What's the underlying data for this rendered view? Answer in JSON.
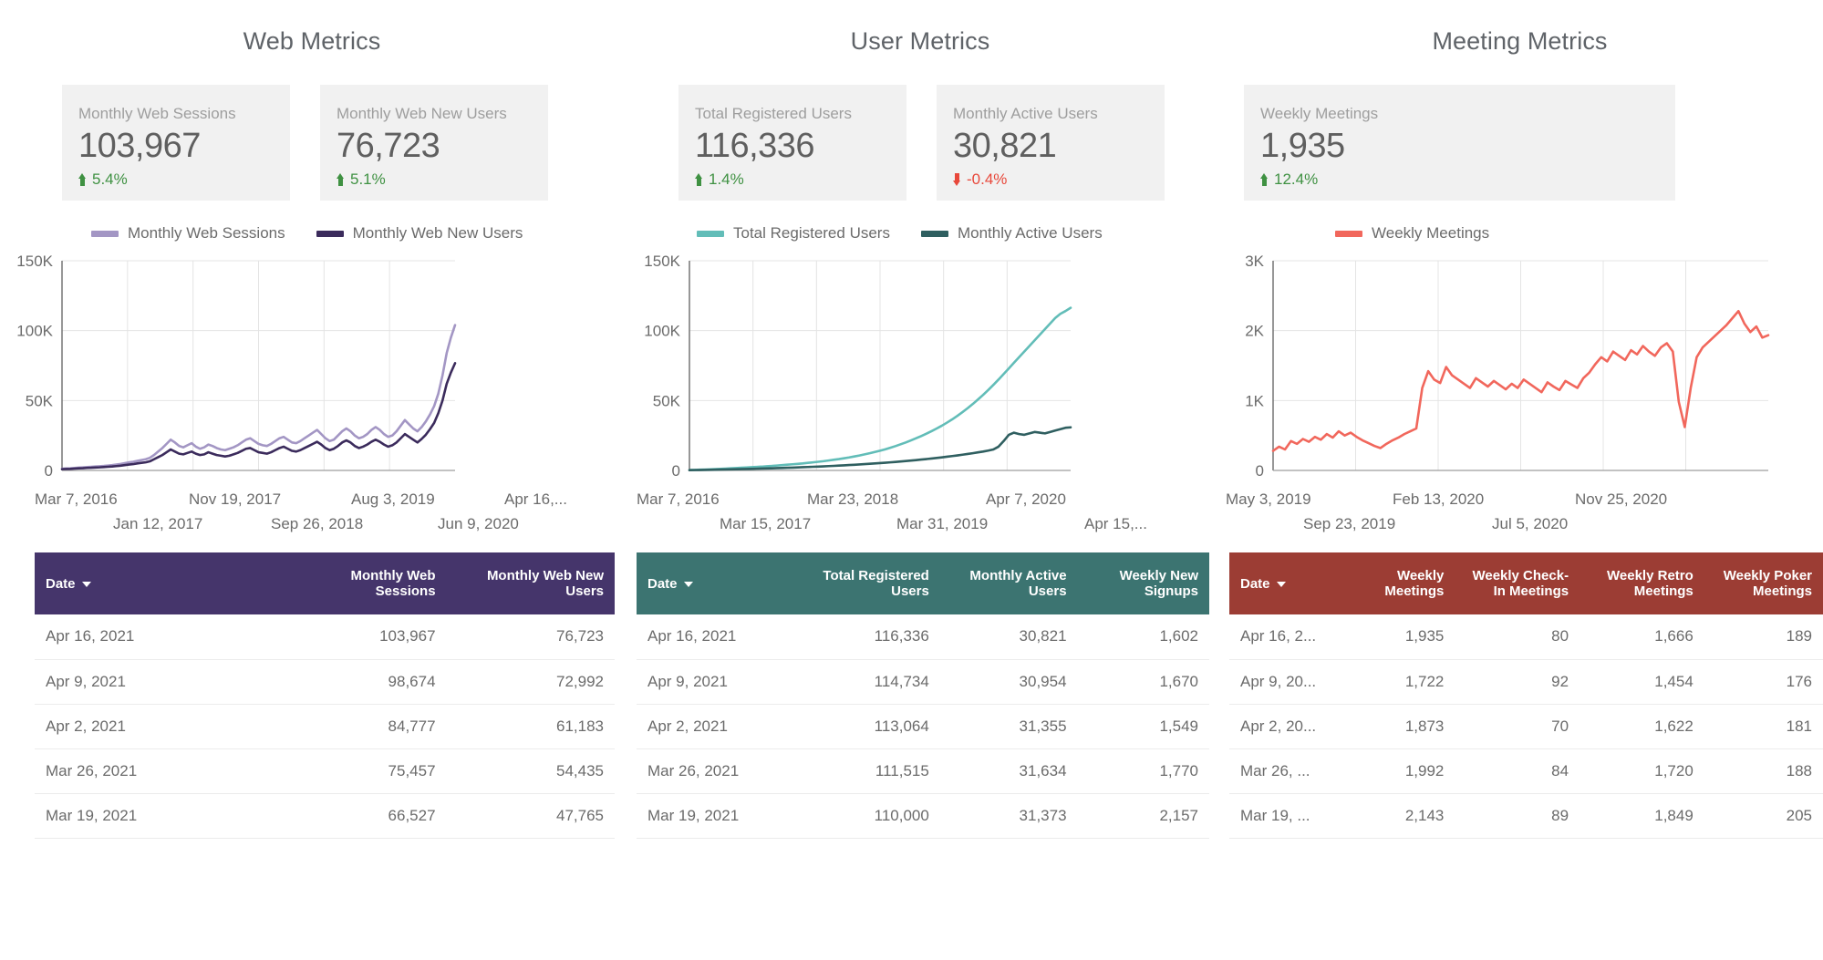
{
  "panels": [
    {
      "title": "Web Metrics",
      "scorecards": [
        {
          "label": "Monthly Web Sessions",
          "value": "103,967",
          "delta": "5.4%",
          "direction": "up"
        },
        {
          "label": "Monthly Web New Users",
          "value": "76,723",
          "delta": "5.1%",
          "direction": "up"
        }
      ],
      "legend": [
        {
          "label": "Monthly Web Sessions",
          "color": "#a396c4"
        },
        {
          "label": "Monthly Web New Users",
          "color": "#3b2b5c"
        }
      ],
      "y_ticks": [
        "150K",
        "100K",
        "50K",
        "0"
      ],
      "x_ticks_top": [
        "Mar 7, 2016",
        "Nov 19, 2017",
        "Aug 3, 2019",
        "Apr 16,..."
      ],
      "x_ticks_bottom": [
        "Jan 12, 2017",
        "Sep 26, 2018",
        "Jun 9, 2020"
      ],
      "table": {
        "header_color": "#45356b",
        "columns": [
          "Date",
          "Monthly Web Sessions",
          "Monthly Web New Users"
        ],
        "rows": [
          [
            "Apr 16, 2021",
            "103,967",
            "76,723"
          ],
          [
            "Apr 9, 2021",
            "98,674",
            "72,992"
          ],
          [
            "Apr 2, 2021",
            "84,777",
            "61,183"
          ],
          [
            "Mar 26, 2021",
            "75,457",
            "54,435"
          ],
          [
            "Mar 19, 2021",
            "66,527",
            "47,765"
          ]
        ]
      }
    },
    {
      "title": "User Metrics",
      "scorecards": [
        {
          "label": "Total Registered Users",
          "value": "116,336",
          "delta": "1.4%",
          "direction": "up"
        },
        {
          "label": "Monthly Active Users",
          "value": "30,821",
          "delta": "-0.4%",
          "direction": "down"
        }
      ],
      "legend": [
        {
          "label": "Total Registered Users",
          "color": "#62bdb8"
        },
        {
          "label": "Monthly Active Users",
          "color": "#2f5f60"
        }
      ],
      "y_ticks": [
        "150K",
        "100K",
        "50K",
        "0"
      ],
      "x_ticks_top": [
        "Mar 7, 2016",
        "Mar 23, 2018",
        "Apr 7, 2020"
      ],
      "x_ticks_bottom": [
        "Mar 15, 2017",
        "Mar 31, 2019",
        "Apr 15,..."
      ],
      "table": {
        "header_color": "#3c7471",
        "columns": [
          "Date",
          "Total Registered Users",
          "Monthly Active Users",
          "Weekly New Signups"
        ],
        "rows": [
          [
            "Apr 16, 2021",
            "116,336",
            "30,821",
            "1,602"
          ],
          [
            "Apr 9, 2021",
            "114,734",
            "30,954",
            "1,670"
          ],
          [
            "Apr 2, 2021",
            "113,064",
            "31,355",
            "1,549"
          ],
          [
            "Mar 26, 2021",
            "111,515",
            "31,634",
            "1,770"
          ],
          [
            "Mar 19, 2021",
            "110,000",
            "31,373",
            "2,157"
          ]
        ]
      }
    },
    {
      "title": "Meeting Metrics",
      "scorecards": [
        {
          "label": "Weekly Meetings",
          "value": "1,935",
          "delta": "12.4%",
          "direction": "up"
        }
      ],
      "legend": [
        {
          "label": "Weekly Meetings",
          "color": "#f1675c"
        }
      ],
      "y_ticks": [
        "3K",
        "2K",
        "1K",
        "0"
      ],
      "x_ticks_top": [
        "May 3, 2019",
        "Feb 13, 2020",
        "Nov 25, 2020"
      ],
      "x_ticks_bottom": [
        "Sep 23, 2019",
        "Jul 5, 2020"
      ],
      "table": {
        "header_color": "#9c3d34",
        "columns": [
          "Date",
          "Weekly Meetings",
          "Weekly Check-In Meetings",
          "Weekly Retro Meetings",
          "Weekly Poker Meetings"
        ],
        "rows": [
          [
            "Apr 16, 2...",
            "1,935",
            "80",
            "1,666",
            "189"
          ],
          [
            "Apr 9, 20...",
            "1,722",
            "92",
            "1,454",
            "176"
          ],
          [
            "Apr 2, 20...",
            "1,873",
            "70",
            "1,622",
            "181"
          ],
          [
            "Mar 26, ...",
            "1,992",
            "84",
            "1,720",
            "188"
          ],
          [
            "Mar 19, ...",
            "2,143",
            "89",
            "1,849",
            "205"
          ]
        ]
      }
    }
  ],
  "chart_data": [
    {
      "type": "line",
      "title": "Web Metrics",
      "xlabel": "",
      "ylabel": "",
      "ylim": [
        0,
        150000
      ],
      "y_ticks": [
        0,
        50000,
        100000,
        150000
      ],
      "y_ticklabels": [
        "0",
        "50K",
        "100K",
        "150K"
      ],
      "x_range": [
        "Mar 7, 2016",
        "Apr 16, 2021"
      ],
      "x_ticklabels": [
        "Mar 7, 2016",
        "Jan 12, 2017",
        "Nov 19, 2017",
        "Sep 26, 2018",
        "Aug 3, 2019",
        "Jun 9, 2020",
        "Apr 16,..."
      ],
      "grid": true,
      "legend_position": "top",
      "series": [
        {
          "name": "Monthly Web Sessions",
          "color": "#a396c4",
          "values": [
            1200,
            1400,
            1500,
            1800,
            2000,
            2200,
            2400,
            2600,
            2800,
            3000,
            3200,
            3500,
            3800,
            4200,
            4600,
            5200,
            5800,
            6200,
            6800,
            7400,
            8000,
            9000,
            11000,
            13500,
            16000,
            19000,
            22000,
            20000,
            17500,
            16500,
            18000,
            19500,
            17000,
            15500,
            16500,
            18500,
            17500,
            16000,
            15000,
            14500,
            15500,
            16500,
            18000,
            20000,
            22000,
            23000,
            21000,
            19000,
            18000,
            17500,
            19000,
            21000,
            23000,
            24000,
            22000,
            20000,
            19500,
            21000,
            23000,
            25000,
            27000,
            29000,
            26000,
            23000,
            21000,
            22000,
            25000,
            28000,
            30000,
            28000,
            25000,
            23000,
            24000,
            26000,
            29000,
            31000,
            29000,
            26000,
            24000,
            25000,
            28000,
            32000,
            36000,
            33000,
            30000,
            28000,
            31000,
            35000,
            40000,
            46000,
            55000,
            68000,
            84000,
            95000,
            103967
          ]
        },
        {
          "name": "Monthly Web New Users",
          "color": "#3b2b5c",
          "values": [
            900,
            1000,
            1100,
            1300,
            1500,
            1600,
            1800,
            1900,
            2100,
            2200,
            2400,
            2600,
            2800,
            3100,
            3400,
            3800,
            4200,
            4500,
            5000,
            5400,
            5800,
            6500,
            8000,
            9500,
            11000,
            13000,
            15000,
            13500,
            12000,
            11500,
            12500,
            13500,
            12000,
            11000,
            11500,
            13000,
            12000,
            11000,
            10500,
            10000,
            10500,
            11500,
            12500,
            14000,
            15500,
            16000,
            14500,
            13000,
            12500,
            12000,
            13000,
            14500,
            16000,
            17000,
            15500,
            14000,
            13500,
            14500,
            16000,
            17500,
            19000,
            20500,
            18500,
            16000,
            14500,
            15500,
            17500,
            20000,
            21500,
            20000,
            17500,
            16000,
            17000,
            18500,
            20500,
            22000,
            20500,
            18500,
            17000,
            18000,
            20000,
            23000,
            26000,
            24000,
            22000,
            20000,
            22500,
            25500,
            29500,
            34000,
            41000,
            50000,
            62000,
            70000,
            76723
          ]
        }
      ]
    },
    {
      "type": "line",
      "title": "User Metrics",
      "xlabel": "",
      "ylabel": "",
      "ylim": [
        0,
        150000
      ],
      "y_ticks": [
        0,
        50000,
        100000,
        150000
      ],
      "y_ticklabels": [
        "0",
        "50K",
        "100K",
        "150K"
      ],
      "x_range": [
        "Mar 7, 2016",
        "Apr 15, 2021"
      ],
      "x_ticklabels": [
        "Mar 7, 2016",
        "Mar 15, 2017",
        "Mar 23, 2018",
        "Mar 31, 2019",
        "Apr 7, 2020",
        "Apr 15,..."
      ],
      "grid": true,
      "legend_position": "top",
      "series": [
        {
          "name": "Total Registered Users",
          "color": "#62bdb8",
          "values": [
            300,
            400,
            500,
            650,
            800,
            950,
            1100,
            1300,
            1500,
            1700,
            1900,
            2100,
            2300,
            2500,
            2700,
            3000,
            3200,
            3500,
            3800,
            4100,
            4400,
            4700,
            5000,
            5400,
            5800,
            6200,
            6600,
            7100,
            7600,
            8100,
            8700,
            9300,
            10000,
            10700,
            11500,
            12300,
            13200,
            14100,
            15100,
            16200,
            17400,
            18700,
            20000,
            21500,
            23000,
            24600,
            26300,
            28100,
            30000,
            32000,
            34200,
            36500,
            39000,
            41700,
            44500,
            47500,
            50700,
            54000,
            57500,
            61200,
            65000,
            69000,
            73000,
            77000,
            81000,
            85000,
            89000,
            93000,
            97000,
            101000,
            105000,
            109000,
            112000,
            114000,
            116336
          ]
        },
        {
          "name": "Monthly Active Users",
          "color": "#2f5f60",
          "values": [
            200,
            250,
            300,
            380,
            450,
            520,
            600,
            680,
            760,
            850,
            940,
            1030,
            1120,
            1220,
            1320,
            1430,
            1540,
            1660,
            1780,
            1900,
            2030,
            2160,
            2300,
            2450,
            2600,
            2760,
            2920,
            3090,
            3270,
            3450,
            3640,
            3840,
            4050,
            4270,
            4500,
            4740,
            4990,
            5250,
            5520,
            5800,
            6100,
            6400,
            6720,
            7050,
            7400,
            7760,
            8140,
            8530,
            8940,
            9360,
            9800,
            10260,
            10740,
            11240,
            11760,
            12300,
            12900,
            13500,
            14200,
            15000,
            17000,
            21000,
            25500,
            27000,
            26000,
            25500,
            26500,
            27500,
            27000,
            26500,
            27500,
            28500,
            29500,
            30500,
            30821
          ]
        }
      ]
    },
    {
      "type": "line",
      "title": "Meeting Metrics",
      "xlabel": "",
      "ylabel": "",
      "ylim": [
        0,
        3000
      ],
      "y_ticks": [
        0,
        1000,
        2000,
        3000
      ],
      "y_ticklabels": [
        "0",
        "1K",
        "2K",
        "3K"
      ],
      "x_range": [
        "May 3, 2019",
        "Apr 16, 2021"
      ],
      "x_ticklabels": [
        "May 3, 2019",
        "Sep 23, 2019",
        "Feb 13, 2020",
        "Jul 5, 2020",
        "Nov 25, 2020"
      ],
      "grid": true,
      "legend_position": "top",
      "series": [
        {
          "name": "Weekly Meetings",
          "color": "#f1675c",
          "values": [
            280,
            340,
            300,
            420,
            380,
            450,
            410,
            480,
            440,
            520,
            470,
            560,
            500,
            540,
            480,
            430,
            390,
            350,
            320,
            380,
            430,
            470,
            520,
            560,
            600,
            1180,
            1420,
            1300,
            1250,
            1480,
            1360,
            1300,
            1240,
            1180,
            1320,
            1260,
            1200,
            1280,
            1220,
            1160,
            1240,
            1180,
            1300,
            1240,
            1180,
            1120,
            1260,
            1200,
            1150,
            1280,
            1230,
            1180,
            1320,
            1400,
            1520,
            1620,
            1560,
            1700,
            1640,
            1580,
            1720,
            1660,
            1780,
            1700,
            1640,
            1760,
            1820,
            1700,
            980,
            620,
            1180,
            1620,
            1760,
            1840,
            1920,
            2000,
            2080,
            2180,
            2280,
            2100,
            1980,
            2060,
            1900,
            1935
          ]
        }
      ]
    }
  ]
}
